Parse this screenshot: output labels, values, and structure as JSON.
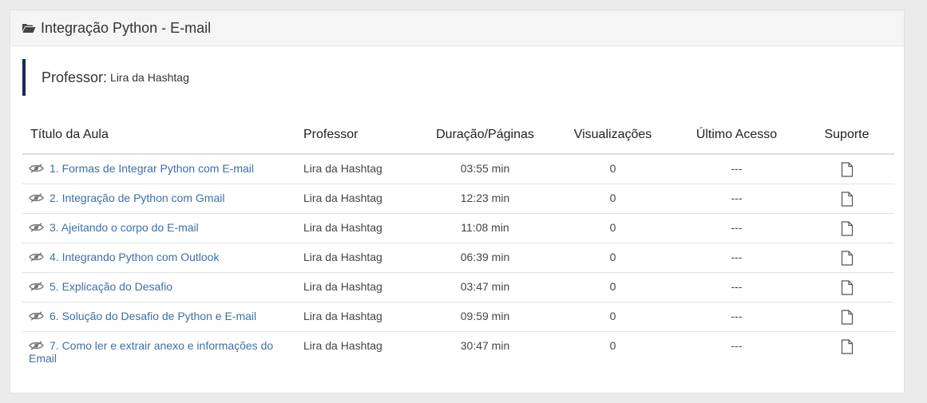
{
  "panel": {
    "title": "Integração Python - E-mail",
    "icon": "folder-open-icon"
  },
  "professor": {
    "label": "Professor:",
    "name": "Lira da Hashtag"
  },
  "table": {
    "headers": [
      "Título da Aula",
      "Professor",
      "Duração/Páginas",
      "Visualizações",
      "Último Acesso",
      "Suporte"
    ],
    "rows": [
      {
        "title": "1. Formas de Integrar Python com E-mail",
        "professor": "Lira da Hashtag",
        "duration": "03:55 min",
        "views": "0",
        "last_access": "---"
      },
      {
        "title": "2. Integração de Python com Gmail",
        "professor": "Lira da Hashtag",
        "duration": "12:23 min",
        "views": "0",
        "last_access": "---"
      },
      {
        "title": "3. Ajeitando o corpo do E-mail",
        "professor": "Lira da Hashtag",
        "duration": "11:08 min",
        "views": "0",
        "last_access": "---"
      },
      {
        "title": "4. Integrando Python com Outlook",
        "professor": "Lira da Hashtag",
        "duration": "06:39 min",
        "views": "0",
        "last_access": "---"
      },
      {
        "title": "5. Explicação do Desafio",
        "professor": "Lira da Hashtag",
        "duration": "03:47 min",
        "views": "0",
        "last_access": "---"
      },
      {
        "title": "6. Solução do Desafio de Python e E-mail",
        "professor": "Lira da Hashtag",
        "duration": "09:59 min",
        "views": "0",
        "last_access": "---"
      },
      {
        "title": "7. Como ler e extrair anexo e informações do Email",
        "professor": "Lira da Hashtag",
        "duration": "30:47 min",
        "views": "0",
        "last_access": "---"
      }
    ]
  },
  "colors": {
    "accent_bar": "#1b2a55",
    "link": "#3d6fa8"
  }
}
